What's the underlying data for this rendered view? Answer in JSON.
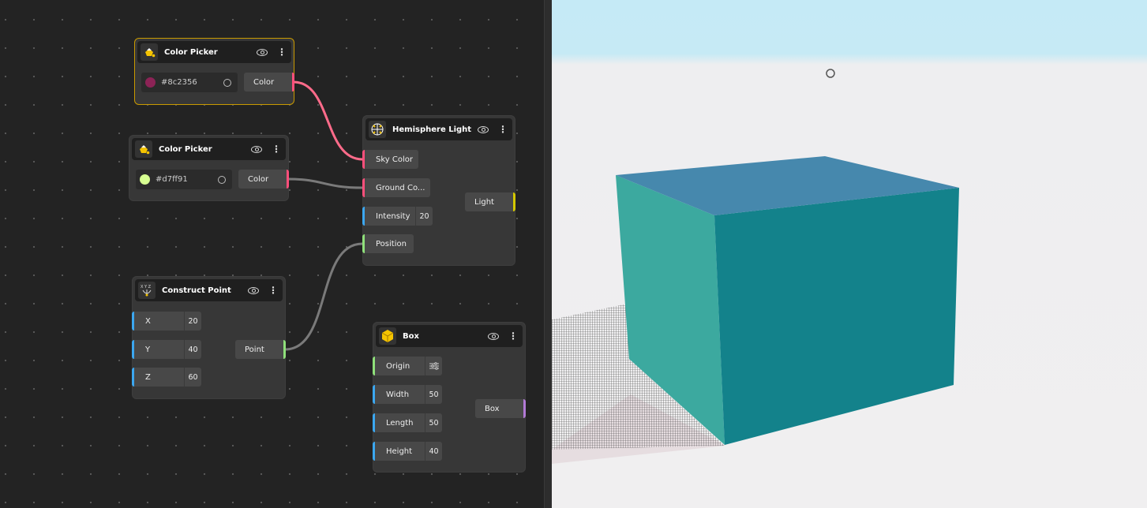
{
  "colors": {
    "selected_border": "#c99a00",
    "color_socket": "#ff4f7b",
    "number_socket": "#3ba7f0",
    "point_socket": "#8fe07a",
    "light_socket": "#d4c800",
    "box_socket": "#b27ad6",
    "wire_active": "#ff6b8a",
    "wire_idle": "#7a7a7a"
  },
  "nodes": {
    "color_picker_1": {
      "title": "Color Picker",
      "value": "#8c2356",
      "swatch": "#8c2356",
      "output": "Color",
      "icon": "paint-bucket-icon"
    },
    "color_picker_2": {
      "title": "Color Picker",
      "value": "#d7ff91",
      "swatch": "#d7ff91",
      "output": "Color",
      "icon": "paint-bucket-icon"
    },
    "hemisphere_light": {
      "title": "Hemisphere Light",
      "icon": "hemisphere-light-icon",
      "inputs": [
        {
          "label": "Sky Color"
        },
        {
          "label": "Ground Co..."
        },
        {
          "label": "Intensity",
          "value": "20"
        },
        {
          "label": "Position"
        }
      ],
      "output": "Light"
    },
    "construct_point": {
      "title": "Construct Point",
      "icon": "xyz-axes-icon",
      "inputs": [
        {
          "label": "X",
          "value": "20"
        },
        {
          "label": "Y",
          "value": "40"
        },
        {
          "label": "Z",
          "value": "60"
        }
      ],
      "output": "Point"
    },
    "box": {
      "title": "Box",
      "icon": "cube-icon",
      "inputs": [
        {
          "label": "Origin"
        },
        {
          "label": "Width",
          "value": "50"
        },
        {
          "label": "Length",
          "value": "50"
        },
        {
          "label": "Height",
          "value": "40"
        }
      ],
      "output": "Box"
    }
  },
  "viewport": {
    "cube_top": "#4688ad",
    "cube_left": "#3ca99f",
    "cube_right": "#13828b"
  }
}
